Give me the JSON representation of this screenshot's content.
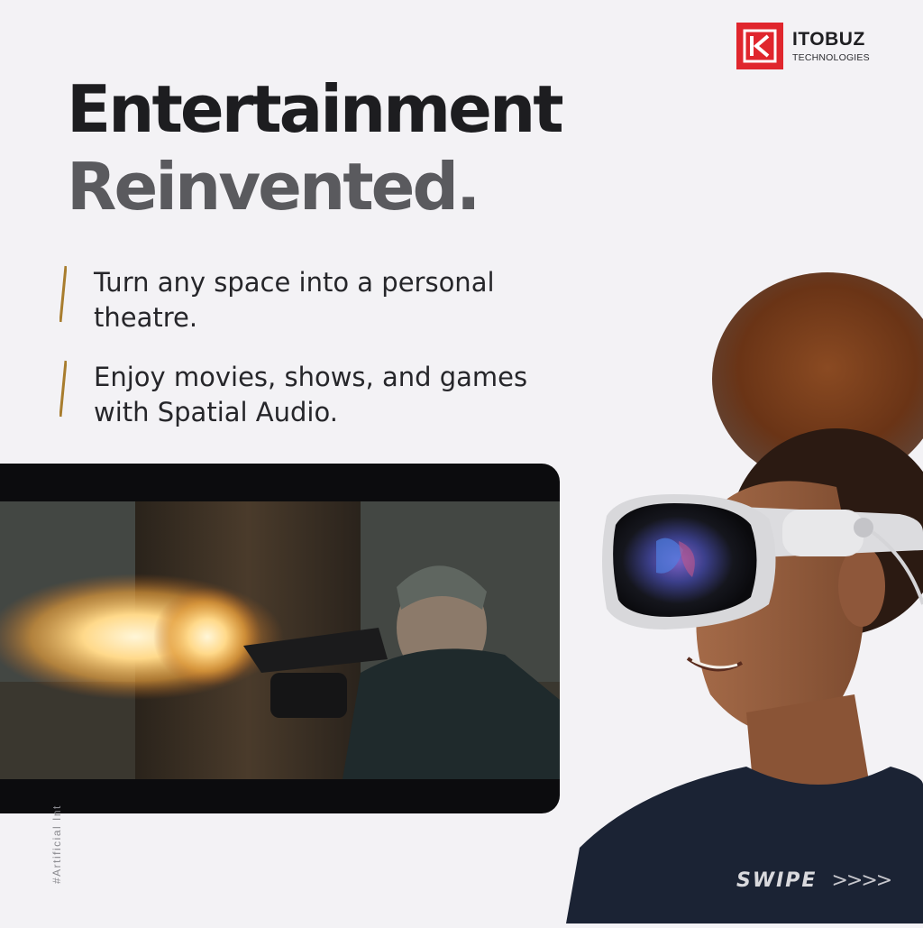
{
  "brand": {
    "name": "ITOBUZ",
    "subtitle": "TECHNOLOGIES",
    "logo_icon": "itobuz-k-logo-icon",
    "accent": "#e0262d"
  },
  "headline": {
    "line1": "Entertainment",
    "line2": "Reinvented."
  },
  "bullets": [
    {
      "text": "Turn any space into a personal theatre.",
      "marker_icon": "slash-icon"
    },
    {
      "text": "Enjoy movies, shows, and games with Spatial Audio.",
      "marker_icon": "slash-icon"
    }
  ],
  "side_tag": "#Artificial Int",
  "video": {
    "description_icon": "movie-still-image"
  },
  "hero_image": {
    "icon": "vision-headset-person-image"
  },
  "swipe": {
    "label": "SWIPE",
    "arrows": ">>>>"
  },
  "colors": {
    "background": "#f3f2f5",
    "headline_primary": "#1d1d20",
    "headline_secondary": "#5a5a5e",
    "slash": "#a87d2e"
  }
}
